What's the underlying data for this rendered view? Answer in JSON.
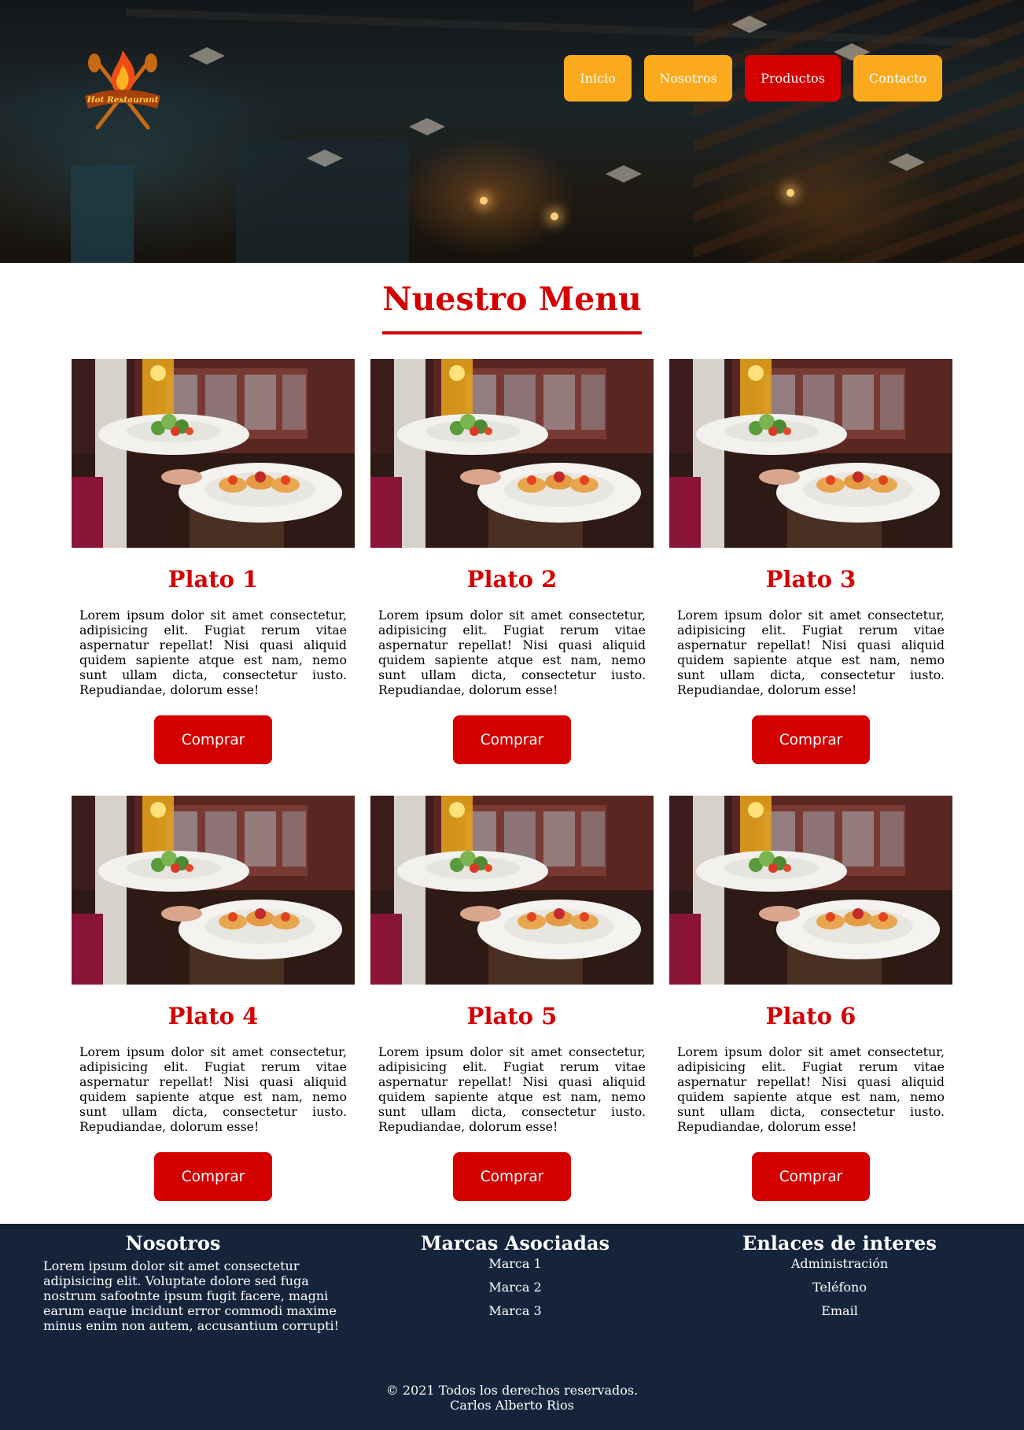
{
  "header": {
    "logo_text": "Hot Restaurant",
    "nav": [
      {
        "label": "Inicio",
        "active": false
      },
      {
        "label": "Nosotros",
        "active": false
      },
      {
        "label": "Productos",
        "active": true
      },
      {
        "label": "Contacto",
        "active": false
      }
    ]
  },
  "menu": {
    "title": "Nuestro Menu",
    "items": [
      {
        "title": "Plato 1",
        "description": "Lorem ipsum dolor sit amet consectetur, adipisicing elit. Fugiat rerum vitae aspernatur repellat! Nisi quasi aliquid quidem sapiente atque est nam, nemo sunt ullam dicta, consectetur iusto. Repudiandae, dolorum esse!",
        "button": "Comprar"
      },
      {
        "title": "Plato 2",
        "description": "Lorem ipsum dolor sit amet consectetur, adipisicing elit. Fugiat rerum vitae aspernatur repellat! Nisi quasi aliquid quidem sapiente atque est nam, nemo sunt ullam dicta, consectetur iusto. Repudiandae, dolorum esse!",
        "button": "Comprar"
      },
      {
        "title": "Plato 3",
        "description": "Lorem ipsum dolor sit amet consectetur, adipisicing elit. Fugiat rerum vitae aspernatur repellat! Nisi quasi aliquid quidem sapiente atque est nam, nemo sunt ullam dicta, consectetur iusto. Repudiandae, dolorum esse!",
        "button": "Comprar"
      },
      {
        "title": "Plato 4",
        "description": "Lorem ipsum dolor sit amet consectetur, adipisicing elit. Fugiat rerum vitae aspernatur repellat! Nisi quasi aliquid quidem sapiente atque est nam, nemo sunt ullam dicta, consectetur iusto. Repudiandae, dolorum esse!",
        "button": "Comprar"
      },
      {
        "title": "Plato 5",
        "description": "Lorem ipsum dolor sit amet consectetur, adipisicing elit. Fugiat rerum vitae aspernatur repellat! Nisi quasi aliquid quidem sapiente atque est nam, nemo sunt ullam dicta, consectetur iusto. Repudiandae, dolorum esse!",
        "button": "Comprar"
      },
      {
        "title": "Plato 6",
        "description": "Lorem ipsum dolor sit amet consectetur, adipisicing elit. Fugiat rerum vitae aspernatur repellat! Nisi quasi aliquid quidem sapiente atque est nam, nemo sunt ullam dicta, consectetur iusto. Repudiandae, dolorum esse!",
        "button": "Comprar"
      }
    ]
  },
  "footer": {
    "nosotros": {
      "title": "Nosotros",
      "text": "Lorem ipsum dolor sit amet consectetur adipisicing elit. Voluptate dolore sed fuga nostrum safootnte ipsum fugit facere, magni earum eaque incidunt error commodi maxime minus enim non autem, accusantium corrupti!"
    },
    "marcas": {
      "title": "Marcas Asociadas",
      "links": [
        "Marca 1",
        "Marca 2",
        "Marca 3"
      ]
    },
    "enlaces": {
      "title": "Enlaces de interes",
      "links": [
        "Administración",
        "Teléfono",
        "Email"
      ]
    },
    "copyright_line1": "© 2021 Todos los derechos reservados.",
    "copyright_line2": "Carlos Alberto Rios"
  },
  "colors": {
    "brand_red": "#d40000",
    "nav_orange": "#fba91d",
    "footer_navy": "#15233b"
  }
}
